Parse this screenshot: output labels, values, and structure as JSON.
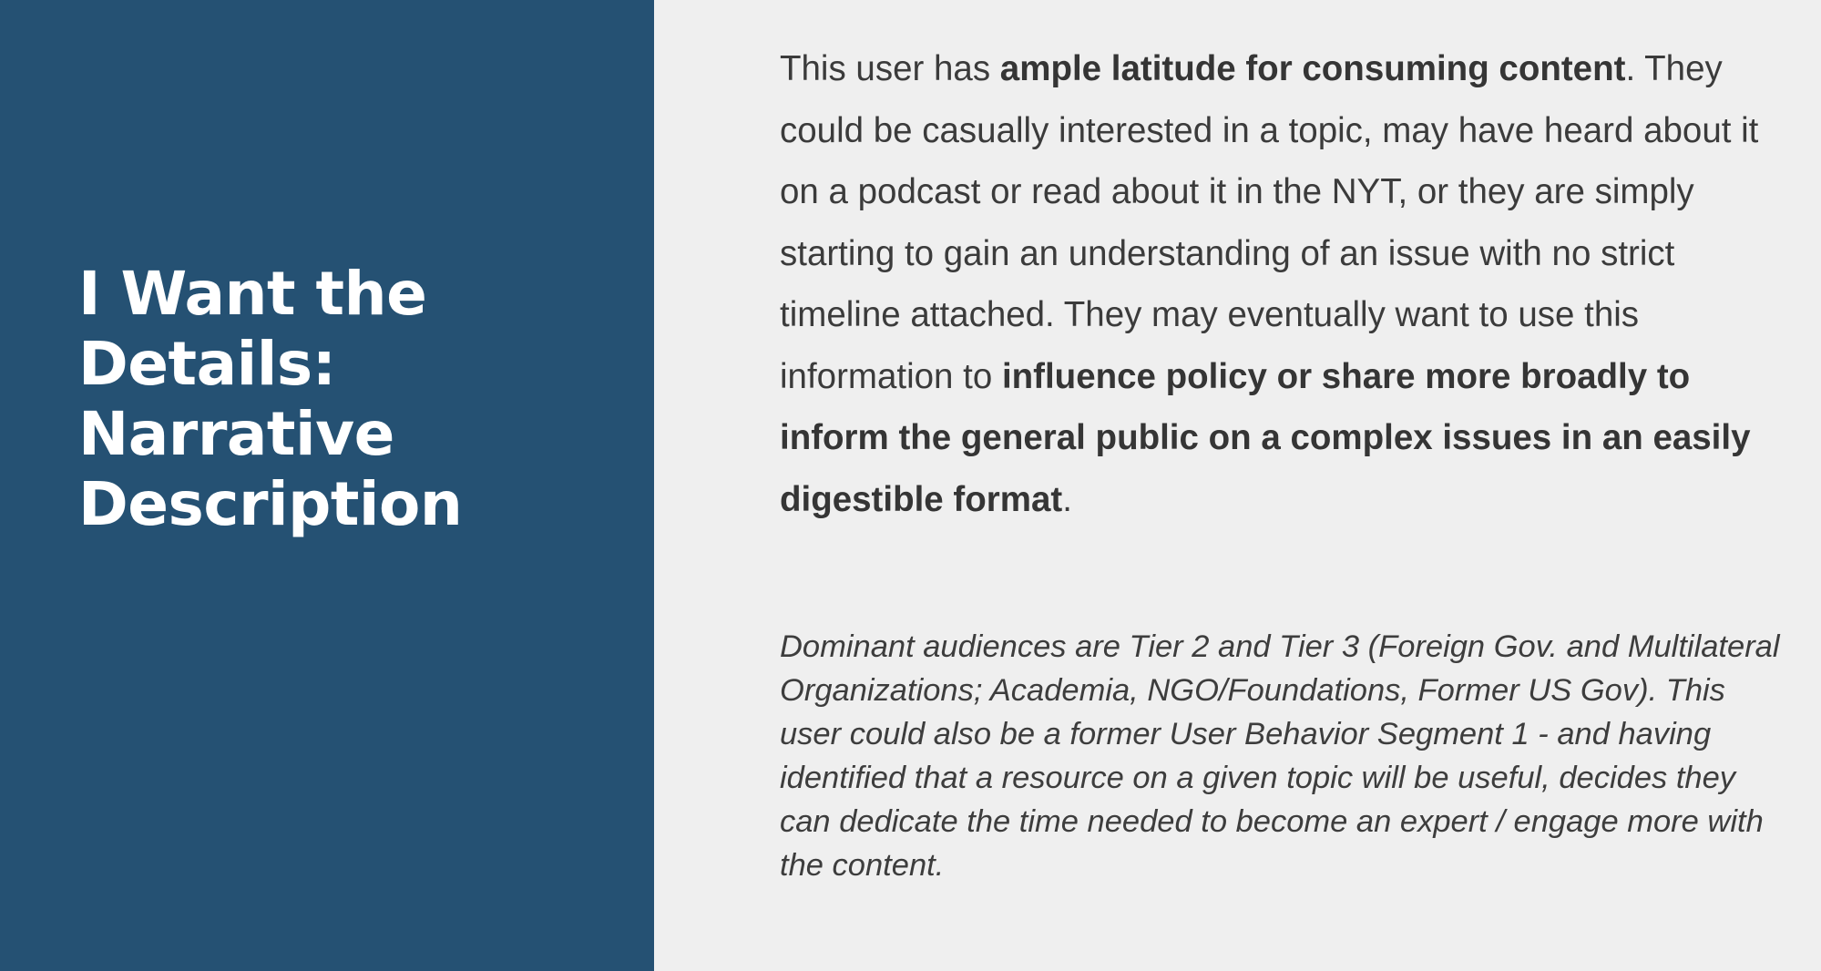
{
  "colors": {
    "left_panel": "#255173",
    "right_panel": "#efefef",
    "title_text": "#ffffff",
    "body_text": "#3b3b3b"
  },
  "title": {
    "line1": "I Want the",
    "line2": "Details:",
    "line3": "Narrative",
    "line4": "Description"
  },
  "paragraph": {
    "part1": "This user has ",
    "bold1": "ample latitude for consuming content",
    "part2": ". They could be casually interested in a topic, may have heard about it on a podcast or read about it in the NYT, or they are simply starting to gain an understanding of an issue with no strict timeline attached. They may eventually want to use this information to ",
    "bold2": "influence policy or share more broadly to inform the general public on a complex issues in an easily digestible format",
    "part3": "."
  },
  "note": {
    "text": "Dominant audiences are Tier 2 and Tier 3 (Foreign Gov. and Multilateral Organizations; Academia, NGO/Foundations, Former US Gov). This user could also be a former User Behavior Segment 1 - and having identified that a resource on a given topic will be useful, decides they can dedicate the time needed to become an expert / engage more with the content."
  }
}
